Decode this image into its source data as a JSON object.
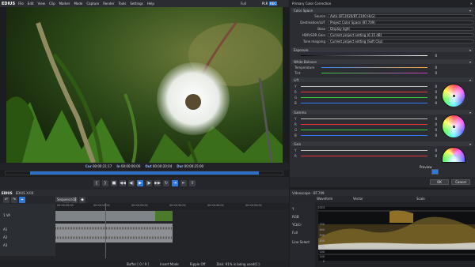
{
  "app": {
    "name": "EDIUS",
    "menu": [
      "File",
      "Edit",
      "View",
      "Clip",
      "Marker",
      "Mode",
      "Capture",
      "Render",
      "Tools",
      "Settings",
      "Help"
    ],
    "view_mode": "Full",
    "plr": "PLR",
    "rec": "REC"
  },
  "player": {
    "timecodes": [
      {
        "label": "Cur",
        "value": "00:00:21:17"
      },
      {
        "label": "In",
        "value": "00:00:00:00"
      },
      {
        "label": "Out",
        "value": "00:00:20:04"
      },
      {
        "label": "Dur",
        "value": "00:00:25:00"
      }
    ],
    "progress": 0.91
  },
  "cc": {
    "title": "Primary Color Correction",
    "color_space_title": "Color Space",
    "rows": [
      {
        "label": "Source",
        "value": "Auto (BT.2020/BT.2100 HLG)"
      },
      {
        "label": "Destination/LUT",
        "value": "Project Color Space (BT.709)"
      },
      {
        "label": "Base",
        "value": "Display light"
      },
      {
        "label": "HDR/SDR Gain",
        "value": "Current project setting (6.15 dB)"
      },
      {
        "label": "Tone mapping",
        "value": "Current project setting (Soft Clip)"
      }
    ],
    "sections": [
      "Exposure",
      "White Balance",
      "Lift",
      "Gamma",
      "Gain"
    ],
    "wb": [
      {
        "label": "Temperature",
        "value": "0"
      },
      {
        "label": "Tint",
        "value": "0"
      }
    ],
    "lift": [
      {
        "label": "Y",
        "value": "0"
      },
      {
        "label": "R",
        "value": "0"
      },
      {
        "label": "G",
        "value": "0"
      },
      {
        "label": "B",
        "value": "0"
      }
    ],
    "gamma": [
      {
        "label": "Y",
        "value": "0"
      },
      {
        "label": "R",
        "value": "0"
      },
      {
        "label": "G",
        "value": "0"
      },
      {
        "label": "B",
        "value": "0"
      }
    ],
    "gain": [
      {
        "label": "Y",
        "value": "0"
      },
      {
        "label": "R",
        "value": "0"
      }
    ],
    "exposure": "0",
    "preview": "Preview",
    "ok": "OK",
    "cancel": "Cancel"
  },
  "timeline": {
    "title": "EDIUS X-R4",
    "seq_tab": "Sequence1",
    "ruler": [
      "00:00:00:00",
      "00:00:10:00",
      "00:00:20:00",
      "00:00:30:00",
      "00:00:40:00",
      "00:00:50:00",
      "00:01:00:00"
    ],
    "tracks": [
      "1 VA",
      "A1",
      "A2",
      "A3"
    ]
  },
  "status": {
    "buffer": "Buffer [ 0 / 9 ]",
    "mode": "Insert Mode",
    "ripple": "Ripple Off",
    "disk": "Disk: 91% is being used(C:)"
  },
  "scope": {
    "title": "Videoscope - BT.709",
    "tabs": [
      "Waveform",
      "Vector",
      "Scale"
    ],
    "ylabels": [
      "1023",
      "700",
      "600",
      "500",
      "400",
      "300",
      "200",
      "100",
      "0"
    ],
    "side": [
      "Y",
      "RGB",
      "YCbCr",
      "Full",
      "Line Select"
    ]
  }
}
